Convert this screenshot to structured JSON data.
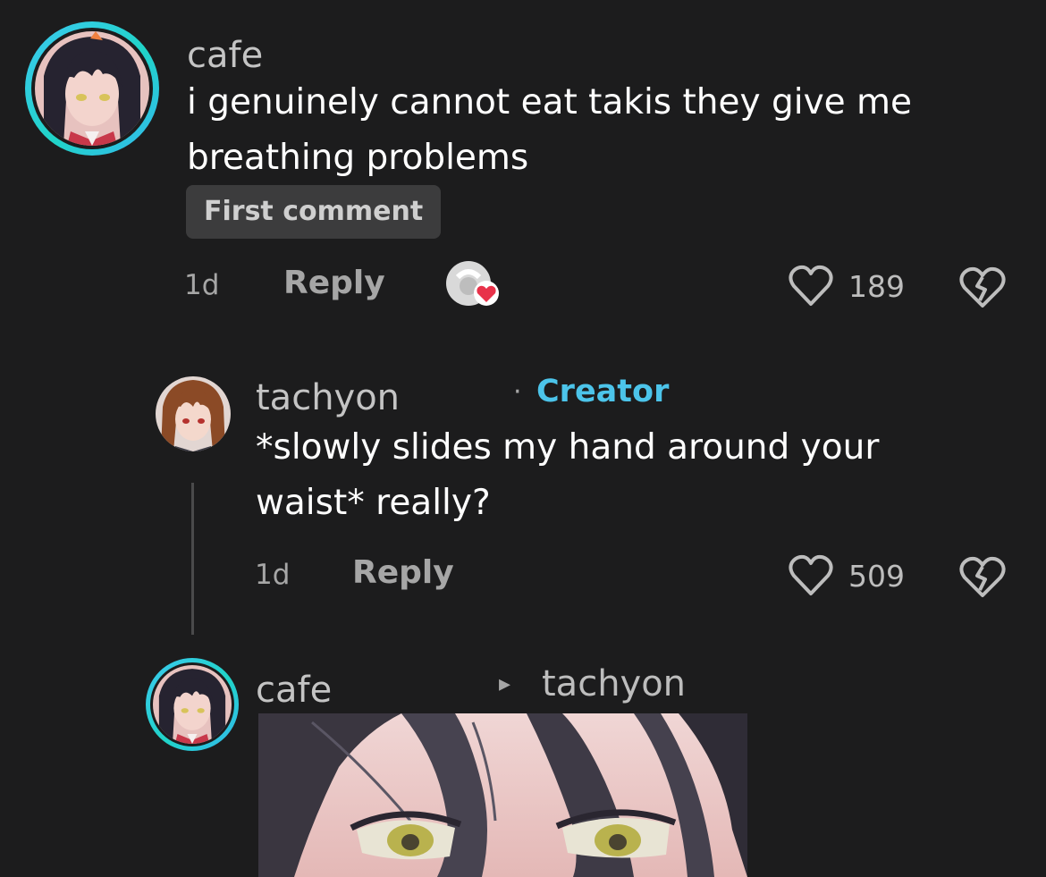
{
  "comments": [
    {
      "username": "cafe",
      "text": "i genuinely cannot eat takis they give me breathing problems",
      "text_line1": "i genuinely cannot eat takis they give me",
      "text_line2": "breathing problems",
      "badge": "First comment",
      "age": "1d",
      "reply_label": "Reply",
      "likes": "189",
      "avatar_icon": "anime-girl-avatar",
      "liked_by_creator_icon": "creator-liked-icon"
    },
    {
      "username": "tachyon",
      "creator_label": "Creator",
      "separator": "·",
      "text": "*slowly slides my hand around your waist* really?",
      "text_line1": "*slowly slides my hand around your",
      "text_line2": "waist* really?",
      "age": "1d",
      "reply_label": "Reply",
      "likes": "509",
      "avatar_icon": "brown-hair-avatar"
    },
    {
      "username": "cafe",
      "reply_to_arrow": "▸",
      "reply_to": "tachyon",
      "avatar_icon": "anime-girl-avatar",
      "attachment": "sticker-image"
    }
  ],
  "colors": {
    "background": "#1c1c1d",
    "creator": "#4cc4ea",
    "like_heart": "#e8324a",
    "story_ring": "#3cc8f0"
  }
}
